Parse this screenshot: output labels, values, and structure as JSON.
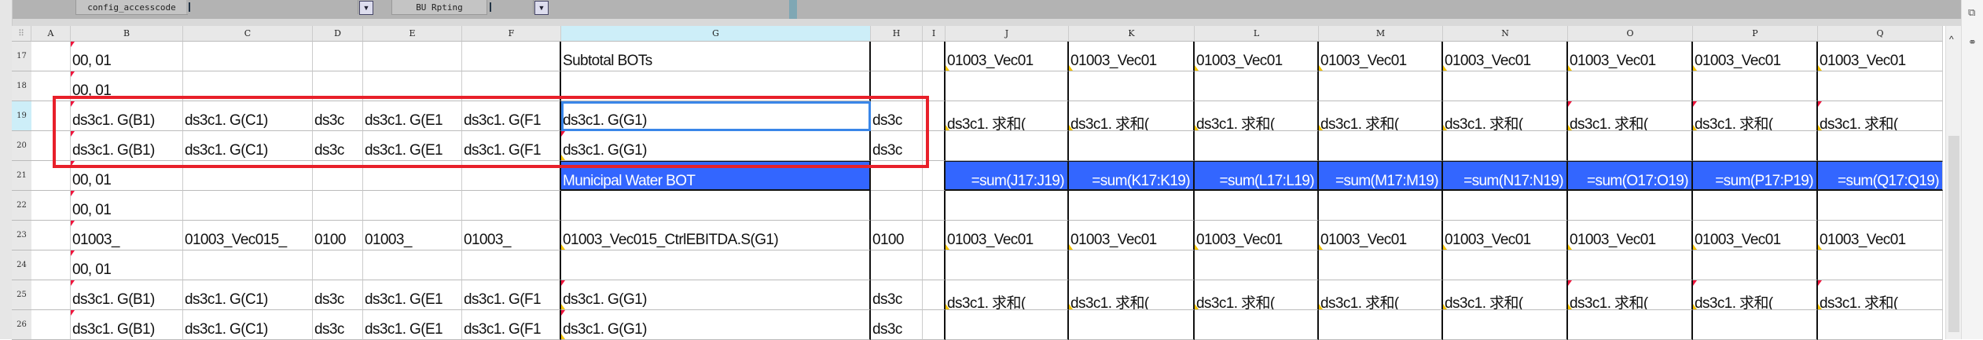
{
  "toolbar": {
    "filters": [
      {
        "label": "config_accesscode",
        "value": ""
      },
      {
        "label": "BU Rpting",
        "value": ""
      }
    ]
  },
  "columns": [
    "A",
    "B",
    "C",
    "D",
    "E",
    "F",
    "G",
    "H",
    "I",
    "J",
    "K",
    "L",
    "M",
    "N",
    "O",
    "P",
    "Q"
  ],
  "selected_column": "G",
  "selected_row": "19",
  "selected_cell": "G19",
  "colors": {
    "highlight_fill": "#3366ff",
    "annotation_box": "#e8202a",
    "selection": "#3a86e8"
  },
  "rows": [
    {
      "num": "17",
      "cells": {
        "B": "00, 01",
        "G": "Subtotal BOTs",
        "J": "01003_Vec01",
        "K": "01003_Vec01",
        "L": "01003_Vec01",
        "M": "01003_Vec01",
        "N": "01003_Vec01",
        "O": "01003_Vec01",
        "P": "01003_Vec01",
        "Q": "01003_Vec01"
      }
    },
    {
      "num": "18",
      "cells": {
        "B": "00, 01"
      }
    },
    {
      "num": "19",
      "cells": {
        "B": "ds3c1. G(B1)",
        "C": "ds3c1. G(C1)",
        "D": "ds3c",
        "E": "ds3c1. G(E1",
        "F": "ds3c1. G(F1",
        "G": "ds3c1. G(G1)",
        "H": "ds3c",
        "J": "ds3c1. 求和(",
        "K": "ds3c1. 求和(",
        "L": "ds3c1. 求和(",
        "M": "ds3c1. 求和(",
        "N": "ds3c1. 求和(",
        "O": "ds3c1. 求和(",
        "P": "ds3c1. 求和(",
        "Q": "ds3c1. 求和("
      }
    },
    {
      "num": "20",
      "cells": {
        "B": "ds3c1. G(B1)",
        "C": "ds3c1. G(C1)",
        "D": "ds3c",
        "E": "ds3c1. G(E1",
        "F": "ds3c1. G(F1",
        "G": "ds3c1. G(G1)",
        "H": "ds3c"
      }
    },
    {
      "num": "21",
      "highlight": true,
      "cells": {
        "B": "00, 01",
        "G": "Municipal Water BOT",
        "J": "=sum(J17:J19)",
        "K": "=sum(K17:K19)",
        "L": "=sum(L17:L19)",
        "M": "=sum(M17:M19)",
        "N": "=sum(N17:N19)",
        "O": "=sum(O17:O19)",
        "P": "=sum(P17:P19)",
        "Q": "=sum(Q17:Q19)"
      }
    },
    {
      "num": "22",
      "cells": {
        "B": "00, 01"
      }
    },
    {
      "num": "23",
      "cells": {
        "B": "01003_",
        "C": "01003_Vec015_",
        "D": "0100",
        "E": "01003_",
        "F": "01003_",
        "G": "01003_Vec015_CtrlEBITDA.S(G1)",
        "H": "0100",
        "J": "01003_Vec01",
        "K": "01003_Vec01",
        "L": "01003_Vec01",
        "M": "01003_Vec01",
        "N": "01003_Vec01",
        "O": "01003_Vec01",
        "P": "01003_Vec01",
        "Q": "01003_Vec01"
      }
    },
    {
      "num": "24",
      "cells": {
        "B": "00, 01"
      }
    },
    {
      "num": "25",
      "cells": {
        "B": "ds3c1. G(B1)",
        "C": "ds3c1. G(C1)",
        "D": "ds3c",
        "E": "ds3c1. G(E1",
        "F": "ds3c1. G(F1",
        "G": "ds3c1. G(G1)",
        "H": "ds3c",
        "J": "ds3c1. 求和(",
        "K": "ds3c1. 求和(",
        "L": "ds3c1. 求和(",
        "M": "ds3c1. 求和(",
        "N": "ds3c1. 求和(",
        "O": "ds3c1. 求和(",
        "P": "ds3c1. 求和(",
        "Q": "ds3c1. 求和("
      }
    },
    {
      "num": "26",
      "cells": {
        "B": "ds3c1. G(B1)",
        "C": "ds3c1. G(C1)",
        "D": "ds3c",
        "E": "ds3c1. G(E1",
        "F": "ds3c1. G(F1",
        "G": "ds3c1. G(G1)",
        "H": "ds3c"
      }
    }
  ]
}
